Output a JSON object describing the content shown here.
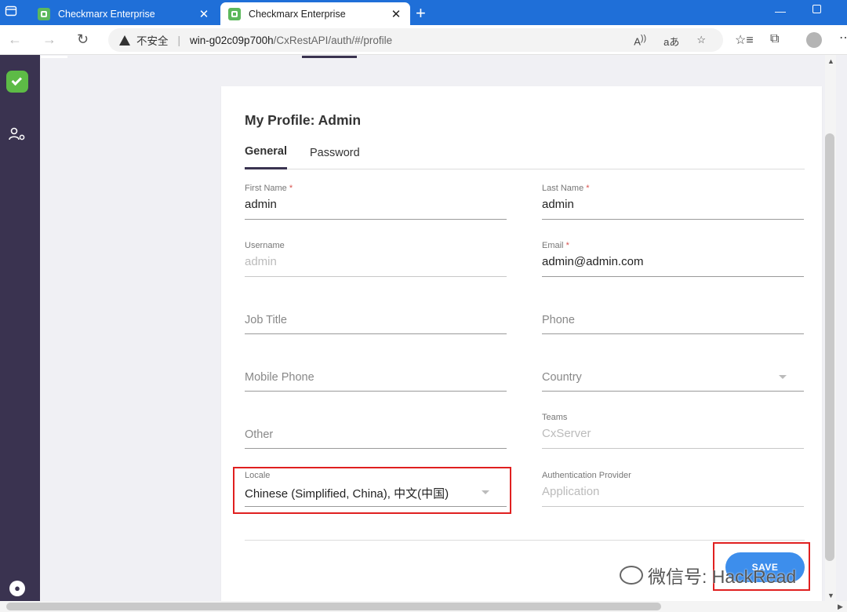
{
  "browser": {
    "tabs": [
      {
        "title": "Checkmarx Enterprise",
        "active": false
      },
      {
        "title": "Checkmarx Enterprise",
        "active": true
      }
    ],
    "security_label": "不安全",
    "url_host": "win-g02c09p700h",
    "url_path": "/CxRestAPI/auth/#/profile"
  },
  "profile": {
    "title": "My Profile: Admin",
    "tabs": {
      "general": "General",
      "password": "Password"
    },
    "fields": {
      "first_name": {
        "label": "First Name",
        "required": "*",
        "value": "admin"
      },
      "last_name": {
        "label": "Last Name",
        "required": "*",
        "value": "admin"
      },
      "username": {
        "label": "Username",
        "value": "admin"
      },
      "email": {
        "label": "Email",
        "required": "*",
        "value": "admin@admin.com"
      },
      "job_title": {
        "placeholder": "Job Title"
      },
      "phone": {
        "placeholder": "Phone"
      },
      "mobile_phone": {
        "placeholder": "Mobile Phone"
      },
      "country": {
        "placeholder": "Country"
      },
      "other": {
        "placeholder": "Other"
      },
      "teams": {
        "label": "Teams",
        "value": "CxServer"
      },
      "locale": {
        "label": "Locale",
        "value": "Chinese (Simplified, China), 中文(中国)"
      },
      "auth_provider": {
        "label": "Authentication Provider",
        "value": "Application"
      }
    },
    "save_label": "SAVE"
  },
  "watermark": "微信号: HackRead",
  "colors": {
    "sidebar": "#3a3350",
    "accent": "#3d8eec",
    "tabstrip": "#1f6fd8",
    "highlight": "#e02020"
  }
}
